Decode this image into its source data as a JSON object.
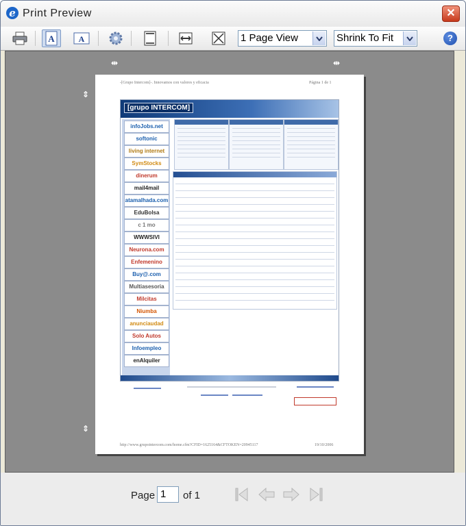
{
  "window": {
    "title": "Print Preview",
    "close_glyph": "✕"
  },
  "toolbar": {
    "print_icon": "printer-icon",
    "portrait_label": "A",
    "landscape_label": "A",
    "page_setup_icon": "gear-icon",
    "header_footer_icon": "header-footer-icon",
    "full_width_icon": "full-width-icon",
    "full_page_icon": "full-page-icon",
    "view_select": "1 Page View",
    "scale_select": "Shrink To Fit",
    "help_glyph": "?"
  },
  "preview": {
    "header_left": "-[Grupo Intercom]-. Innovamos con valores y eficacia",
    "header_right": "Página 1 de 1",
    "footer_left": "http://www.grupointercom.com/home.cfm?CFID=1625164&CFTOKEN=20945117",
    "footer_right": "19/10/2006",
    "site_brand": "[grupo INTERCOM]",
    "sidebar_logos": [
      "infoJobs.net",
      "softonic",
      "living internet",
      "SymStocks",
      "dinerum",
      "mail4mail",
      "atamalhada.com",
      "EduBolsa",
      "c 1 mo",
      "WWWSIVI",
      "Neurona.com",
      "Enfemenino",
      "Buy@.com",
      "Multiasesoria",
      "Milcitas",
      "Niumba",
      "anunciaudad",
      "Solo Autos",
      "Infoempleo",
      "enAlquiler"
    ]
  },
  "status": {
    "page_label": "Page",
    "page_value": "1",
    "of_label": "of 1"
  }
}
